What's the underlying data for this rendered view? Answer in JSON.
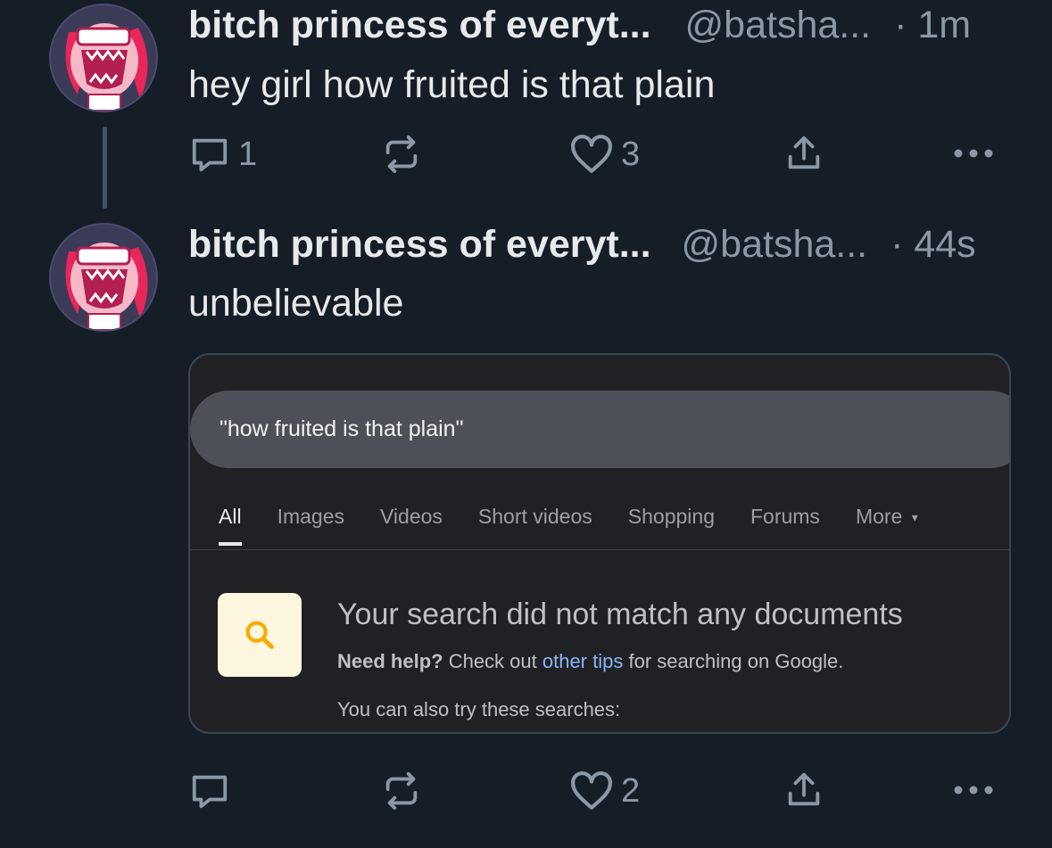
{
  "tweets": [
    {
      "name": "bitch princess of everyt...",
      "handle": "@batsha...",
      "time": "· 1m",
      "text": "hey girl how fruited is that plain",
      "reply_count": "1",
      "retweet_count": "",
      "like_count": "3"
    },
    {
      "name": "bitch princess of everyt...",
      "handle": "@batsha...",
      "time": "· 44s",
      "text": "unbelievable",
      "reply_count": "",
      "retweet_count": "",
      "like_count": "2"
    }
  ],
  "embed": {
    "query": "\"how fruited is that plain\"",
    "tabs": [
      "All",
      "Images",
      "Videos",
      "Short videos",
      "Shopping",
      "Forums",
      "More"
    ],
    "more_caret": "▾",
    "no_results_title": "Your search did not match any documents",
    "help_bold": "Need help?",
    "help_pre": " Check out ",
    "help_link": "other tips",
    "help_post": " for searching on Google.",
    "also_try": "You can also try these searches:"
  },
  "colors": {
    "background": "#151d27",
    "text_primary": "#e7e9ea",
    "text_secondary": "#8b98a5",
    "link": "#8ab4f8",
    "search_icon": "#f9ab00"
  },
  "icons": [
    "reply-icon",
    "retweet-icon",
    "like-icon",
    "share-icon",
    "more-icon",
    "search-icon"
  ]
}
